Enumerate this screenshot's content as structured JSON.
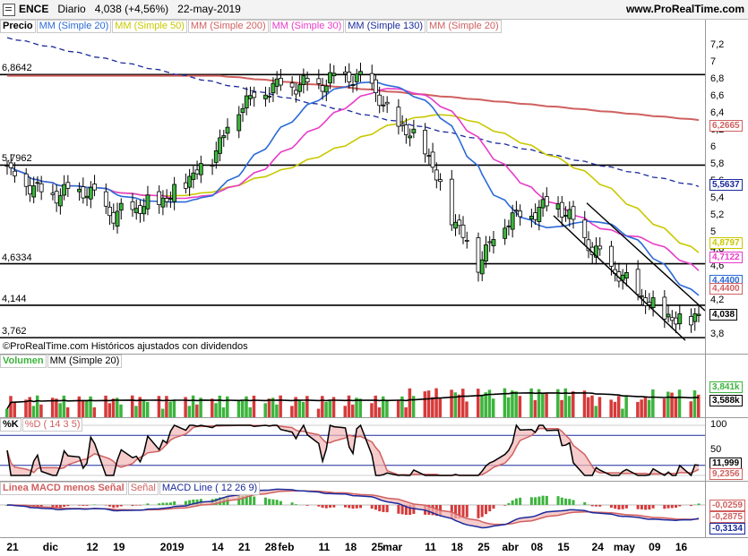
{
  "header": {
    "ticker": "ENCE",
    "timeframe": "Diario",
    "last": "4,038",
    "change": "(+4,56%)",
    "date": "22-may-2019",
    "site": "www.ProRealTime.com"
  },
  "price_panel": {
    "legend": [
      {
        "label": "Precio",
        "color": "#000000"
      },
      {
        "label": "MM (Simple 20)",
        "color": "#2a6ad8"
      },
      {
        "label": "MM (Simple 50)",
        "color": "#c8c800"
      },
      {
        "label": "MM (Simple 200)",
        "color": "#d06060"
      },
      {
        "label": "MM (Simple 30)",
        "color": "#e83cc8"
      },
      {
        "label": "MM (Simple 130)",
        "color": "#1a2a9c"
      },
      {
        "label": "MM (Simple 20)",
        "color": "#d06060"
      }
    ],
    "axis_ticks": [
      "7,2",
      "7",
      "6,8",
      "6,6",
      "6,4",
      "6,2",
      "6",
      "5,8",
      "5,6",
      "5,4",
      "5,2",
      "5",
      "4,8",
      "4,6",
      "4,4",
      "4,2",
      "4",
      "3,8"
    ],
    "hlines": [
      "6,8642",
      "5,7962",
      "4,6334",
      "4,144",
      "3,762"
    ],
    "badges": [
      {
        "text": "6,2665",
        "color": "#d06060"
      },
      {
        "text": "5,5637",
        "color": "#1a2a9c"
      },
      {
        "text": "4,8797",
        "color": "#c8c800"
      },
      {
        "text": "4,7122",
        "color": "#e83cc8"
      },
      {
        "text": "4,4400",
        "color": "#2a6ad8"
      },
      {
        "text": "4,4400",
        "color": "#d06060"
      },
      {
        "text": "4,038",
        "color": "#000000"
      }
    ],
    "copyright": "©ProRealTime.com Históricos ajustados con dividendos"
  },
  "volume_panel": {
    "legend": [
      {
        "label": "Volumen",
        "color": "#3cb43c"
      },
      {
        "label": "MM (Simple 20)",
        "color": "#000000"
      }
    ],
    "badges": [
      {
        "text": "3,841k",
        "color": "#3cb43c"
      },
      {
        "text": "3,588k",
        "color": "#000000"
      }
    ]
  },
  "stoch_panel": {
    "legend": [
      {
        "label": "%K",
        "color": "#000000"
      },
      {
        "label": "%D ( 14 3 5)",
        "color": "#d06060"
      }
    ],
    "axis_ticks": [
      "100",
      "50",
      "0"
    ],
    "badges": [
      {
        "text": "11,999",
        "color": "#000000"
      },
      {
        "text": "9,2356",
        "color": "#d06060"
      }
    ]
  },
  "macd_panel": {
    "legend": [
      {
        "label": "Linea MACD menos Señal",
        "color": "#d06060"
      },
      {
        "label": "Señal",
        "color": "#d06060"
      },
      {
        "label": "MACD Line ( 12 26 9)",
        "color": "#1a2a9c"
      }
    ],
    "badges": [
      {
        "text": "-0,0259",
        "color": "#d06060"
      },
      {
        "text": "-0,2875",
        "color": "#d06060"
      },
      {
        "text": "-0,3134",
        "color": "#1a2a9c"
      }
    ]
  },
  "x_labels": [
    "21",
    "dic",
    "12",
    "19",
    "2019",
    "14",
    "21",
    "28",
    "feb",
    "11",
    "18",
    "25",
    "mar",
    "11",
    "18",
    "25",
    "abr",
    "08",
    "15",
    "24",
    "may",
    "09",
    "16"
  ],
  "chart_data": {
    "type": "candlestick",
    "title": "ENCE Diario",
    "x_range": [
      "21-nov-2018",
      "22-may-2019"
    ],
    "ylim": [
      3.7,
      7.3
    ],
    "close_series_approx": [
      {
        "x": "2018-11-21",
        "y": 5.75
      },
      {
        "x": "2018-12-01",
        "y": 5.45
      },
      {
        "x": "2018-12-12",
        "y": 5.5
      },
      {
        "x": "2018-12-19",
        "y": 5.2
      },
      {
        "x": "2019-01-02",
        "y": 5.4
      },
      {
        "x": "2019-01-14",
        "y": 5.9
      },
      {
        "x": "2019-01-21",
        "y": 6.5
      },
      {
        "x": "2019-01-28",
        "y": 6.7
      },
      {
        "x": "2019-02-01",
        "y": 6.75
      },
      {
        "x": "2019-02-11",
        "y": 6.75
      },
      {
        "x": "2019-02-18",
        "y": 6.85
      },
      {
        "x": "2019-02-25",
        "y": 6.75
      },
      {
        "x": "2019-03-01",
        "y": 6.4
      },
      {
        "x": "2019-03-11",
        "y": 6.0
      },
      {
        "x": "2019-03-18",
        "y": 5.2
      },
      {
        "x": "2019-03-25",
        "y": 4.65
      },
      {
        "x": "2019-04-01",
        "y": 5.15
      },
      {
        "x": "2019-04-08",
        "y": 5.25
      },
      {
        "x": "2019-04-15",
        "y": 5.35
      },
      {
        "x": "2019-04-24",
        "y": 4.8
      },
      {
        "x": "2019-05-01",
        "y": 4.5
      },
      {
        "x": "2019-05-09",
        "y": 4.15
      },
      {
        "x": "2019-05-16",
        "y": 3.95
      },
      {
        "x": "2019-05-22",
        "y": 4.038
      }
    ],
    "horizontal_levels": [
      6.8642,
      5.7962,
      4.6334,
      4.144,
      3.762
    ],
    "moving_averages_last": {
      "MM20": 4.44,
      "MM50": 4.8797,
      "MM200": 6.2665,
      "MM30": 4.7122,
      "MM130": 5.5637
    },
    "volume_last": 3.841,
    "volume_ma20_last": 3.588,
    "stochastic_last": {
      "K": 11.999,
      "D": 9.2356
    },
    "macd_last": {
      "histogram": -0.0259,
      "signal": -0.2875,
      "macd": -0.3134
    }
  }
}
